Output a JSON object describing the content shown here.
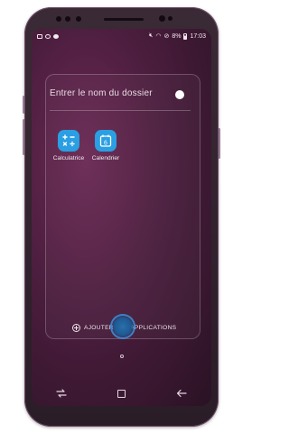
{
  "statusbar": {
    "battery": "8%",
    "time": "17:03"
  },
  "folder": {
    "name_placeholder": "Entrer le nom du dossier"
  },
  "apps": [
    {
      "label": "Calculatrice",
      "icon": "calculator-icon"
    },
    {
      "label": "Calendrier",
      "icon": "calendar-icon",
      "day": "6"
    }
  ],
  "actions": {
    "add_apps_label": "AJOUTER DES APPLICATIONS"
  },
  "navbar": {
    "recent": "recent-apps-icon",
    "home": "home-icon",
    "back": "back-icon"
  },
  "colors": {
    "accent": "#2a9fe3",
    "wallpaper": "#4a1d3d"
  }
}
